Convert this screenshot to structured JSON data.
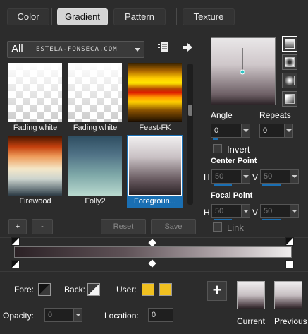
{
  "tabs": [
    {
      "label": "Color",
      "active": false
    },
    {
      "label": "Gradient",
      "active": true
    },
    {
      "label": "Pattern",
      "active": false
    },
    {
      "label": "Texture",
      "active": false
    }
  ],
  "library": {
    "category": "All",
    "watermark": "ESTELA-FONSECA.COM",
    "items": [
      {
        "name": "Fading white",
        "selected": false
      },
      {
        "name": "Fading white",
        "selected": false
      },
      {
        "name": "Feast-FK",
        "selected": false
      },
      {
        "name": "Firewood",
        "selected": false
      },
      {
        "name": "Folly2",
        "selected": false
      },
      {
        "name": "Foregroun...",
        "selected": true
      }
    ],
    "add_label": "+",
    "remove_label": "-",
    "reset_label": "Reset",
    "save_label": "Save"
  },
  "settings": {
    "angle_label": "Angle",
    "angle_value": "0",
    "repeats_label": "Repeats",
    "repeats_value": "0",
    "invert_label": "Invert",
    "center_label": "Center Point",
    "h_label": "H",
    "v_label": "V",
    "center_h": "50",
    "center_v": "50",
    "focal_label": "Focal Point",
    "focal_h": "50",
    "focal_v": "50",
    "link_label": "Link"
  },
  "bottom": {
    "fore_label": "Fore:",
    "back_label": "Back:",
    "user_label": "User:",
    "user_color": "#f0c020",
    "opacity_label": "Opacity:",
    "opacity_value": "0",
    "location_label": "Location:",
    "location_value": "0",
    "add_label": "+",
    "current_label": "Current",
    "previous_label": "Previous"
  }
}
